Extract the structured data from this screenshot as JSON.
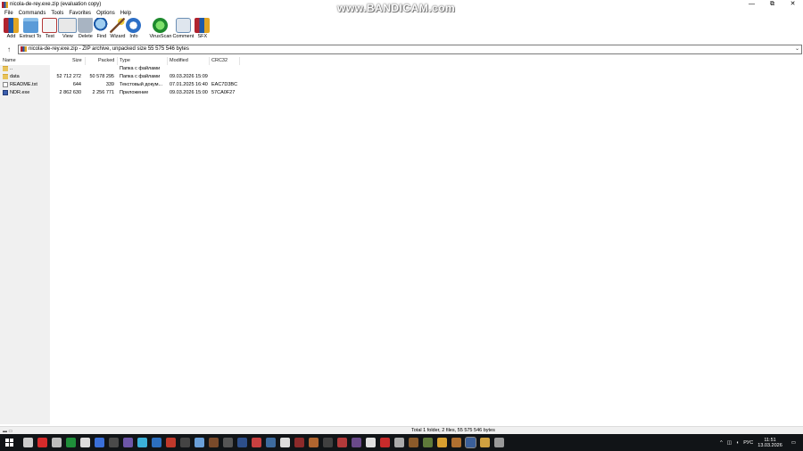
{
  "window": {
    "title": "nicola-de-rey.exe.zip (evaluation copy)",
    "watermark": "www.BANDICAM.com",
    "controls": [
      "—",
      "⧉",
      "✕"
    ]
  },
  "menu": [
    "File",
    "Commands",
    "Tools",
    "Favorites",
    "Options",
    "Help"
  ],
  "toolbar": [
    {
      "label": "Add",
      "icon": "add-icon"
    },
    {
      "label": "Extract To",
      "icon": "extract-icon"
    },
    {
      "label": "Test",
      "icon": "test-icon"
    },
    {
      "label": "View",
      "icon": "view-icon"
    },
    {
      "label": "Delete",
      "icon": "delete-icon"
    },
    {
      "label": "Find",
      "icon": "find-icon"
    },
    {
      "label": "Wizard",
      "icon": "wizard-icon"
    },
    {
      "label": "Info",
      "icon": "info-icon"
    },
    {
      "label": "VirusScan",
      "icon": "virusscan-icon"
    },
    {
      "label": "Comment",
      "icon": "comment-icon"
    },
    {
      "label": "SFX",
      "icon": "sfx-icon"
    }
  ],
  "address": {
    "up": "↑",
    "path": "nicola-de-rey.exe.zip - ZIP archive, unpacked size 55 575 546 bytes",
    "dropdown": "⌄"
  },
  "columns": {
    "name": "Name",
    "size": "Size",
    "packed": "Packed",
    "type": "Type",
    "modified": "Modified",
    "crc": "CRC32"
  },
  "files": [
    {
      "name": "..",
      "size": "",
      "packed": "",
      "type": "Папка с файлами",
      "modified": "",
      "crc": "",
      "kind": "folder"
    },
    {
      "name": "data",
      "size": "52 712 272",
      "packed": "50 578 295",
      "type": "Папка с файлами",
      "modified": "09.03.2026 15:09",
      "crc": "",
      "kind": "folder"
    },
    {
      "name": "README.txt",
      "size": "644",
      "packed": "339",
      "type": "Текстовый докум...",
      "modified": "07.01.2025 16:40",
      "crc": "EAC7D3BC",
      "kind": "txt"
    },
    {
      "name": "NDR.exe",
      "size": "2 862 630",
      "packed": "2 256 771",
      "type": "Приложение",
      "modified": "09.03.2026 15:00",
      "crc": "57CA0F27",
      "kind": "exe"
    }
  ],
  "status": {
    "left": "▬ ▭",
    "text": "Total 1 folder, 2 files, 55 575 546 bytes"
  },
  "taskbar": {
    "tray_lang": "РУС",
    "time": "11:51",
    "date": "13.03.2026",
    "tray_arrow": "^",
    "app_colors": [
      "#cccccc",
      "#d62b2b",
      "#bdbdbd",
      "#1f8f3a",
      "#dddddd",
      "#3a6fd8",
      "#4a4a4a",
      "#6d56a8",
      "#3bb0d8",
      "#2c6fbf",
      "#c0392b",
      "#444444",
      "#6a9fd8",
      "#7a4a2a",
      "#555555",
      "#2d4f8a",
      "#c84040",
      "#3d6b9e",
      "#dddddd",
      "#8c2a2a",
      "#b0652f",
      "#404040",
      "#b33a3a",
      "#6a4a8a",
      "#e0e0e0",
      "#c72b2b",
      "#aaaaaa",
      "#8a5a2a",
      "#5f7a3a",
      "#d9a030",
      "#b07030",
      "#3a5f9a",
      "#cfa040",
      "#999999"
    ]
  }
}
